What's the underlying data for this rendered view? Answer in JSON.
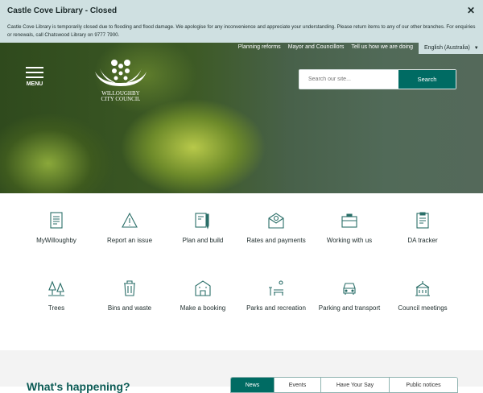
{
  "alert": {
    "title": "Castle Cove Library - Closed",
    "body": "Castle Cove Library is temporarily closed due to flooding and flood damage. We apologise for any inconvenience and appreciate your understanding. Please return items to any of our other branches. For enquiries or renewals, call Chatswood Library on 9777 7900.",
    "close": "✕"
  },
  "header": {
    "links": [
      "Planning reforms",
      "Mayor and Councillors",
      "Tell us how we are doing"
    ],
    "language": "English (Australia)",
    "menu": "MENU",
    "logo_line1": "WILLOUGHBY",
    "logo_line2": "CITY COUNCIL",
    "search_placeholder": "Search our site...",
    "search_button": "Search"
  },
  "tiles": [
    {
      "label": "MyWilloughby",
      "icon": "document-icon"
    },
    {
      "label": "Report an issue",
      "icon": "warning-icon"
    },
    {
      "label": "Plan and build",
      "icon": "plans-icon"
    },
    {
      "label": "Rates and payments",
      "icon": "envelope-money-icon"
    },
    {
      "label": "Working with us",
      "icon": "briefcase-icon"
    },
    {
      "label": "DA tracker",
      "icon": "clipboard-icon"
    },
    {
      "label": "Trees",
      "icon": "trees-icon"
    },
    {
      "label": "Bins and waste",
      "icon": "bin-icon"
    },
    {
      "label": "Make a booking",
      "icon": "building-icon"
    },
    {
      "label": "Parks and recreation",
      "icon": "park-icon"
    },
    {
      "label": "Parking and transport",
      "icon": "car-icon"
    },
    {
      "label": "Council meetings",
      "icon": "council-icon"
    }
  ],
  "happening": {
    "title": "What's happening?",
    "tabs": [
      "News",
      "Events",
      "Have Your Say",
      "Public notices"
    ]
  },
  "colors": {
    "accent": "#006b63",
    "alert_bg": "#cfe0e1"
  }
}
